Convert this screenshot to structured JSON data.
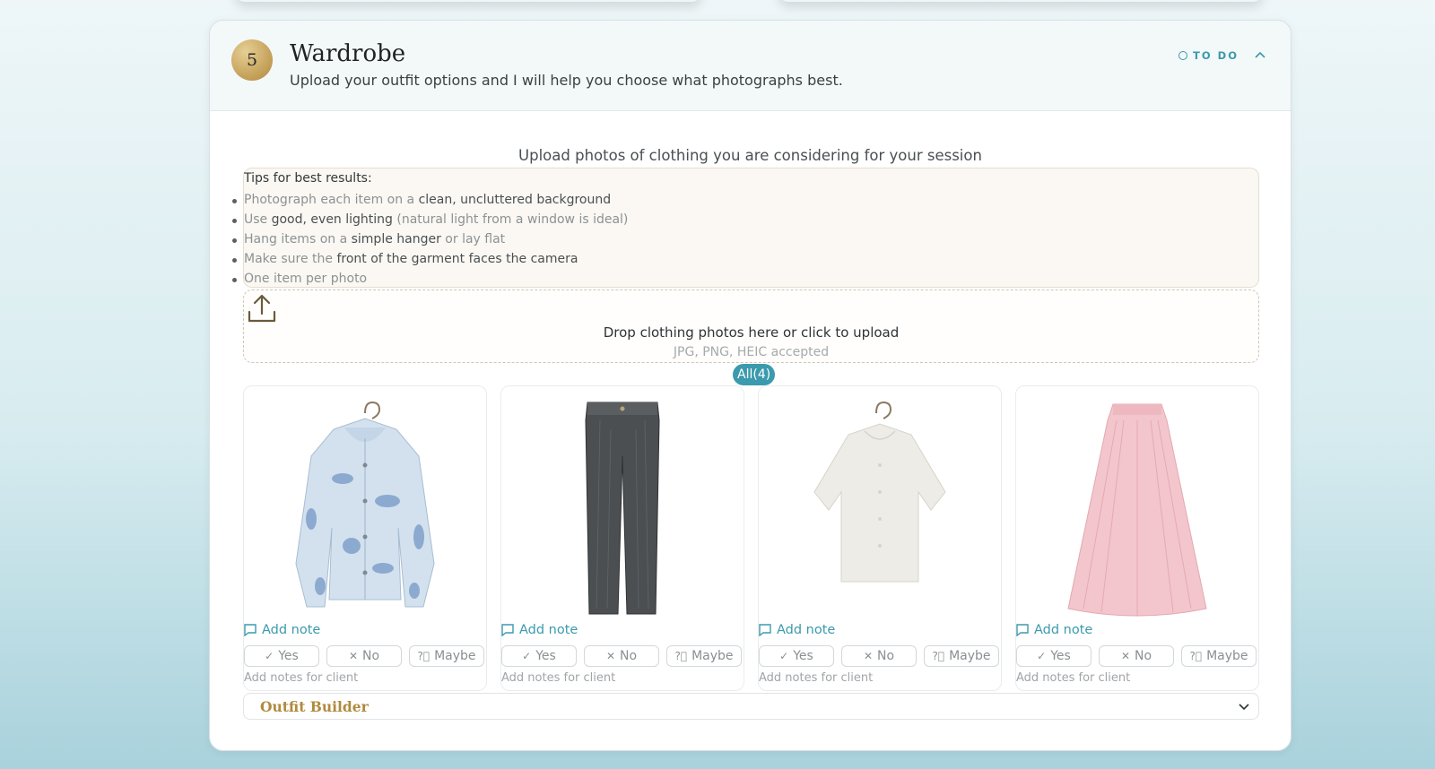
{
  "step": {
    "number": "5",
    "title": "Wardrobe",
    "subtitle": "Upload your outfit options and I will help you choose what photographs best.",
    "status": "TO DO"
  },
  "upload": {
    "heading": "Upload photos of clothing you are considering for your session",
    "tips_title": "Tips for best results:",
    "tips": [
      [
        "Photograph each item on a ",
        "clean, uncluttered background",
        ""
      ],
      [
        "Use ",
        "good, even lighting",
        " (natural light from a window is ideal)"
      ],
      [
        "Hang items on a ",
        "simple hanger",
        " or lay flat"
      ],
      [
        "Make sure the ",
        "front of the garment faces the camera",
        ""
      ],
      [
        "One item per photo",
        "",
        ""
      ]
    ],
    "drop_text": "Drop clothing photos here or click to upload",
    "drop_sub": "JPG, PNG, HEIC accepted"
  },
  "filter": {
    "label": "All(4)"
  },
  "items": [
    {
      "kind": "denim-jacket",
      "add_note": "Add note",
      "yes": "Yes",
      "no": "No",
      "maybe": "Maybe",
      "client_notes": "Add notes for client"
    },
    {
      "kind": "jeans",
      "add_note": "Add note",
      "yes": "Yes",
      "no": "No",
      "maybe": "Maybe",
      "client_notes": "Add notes for client"
    },
    {
      "kind": "knit-top",
      "add_note": "Add note",
      "yes": "Yes",
      "no": "No",
      "maybe": "Maybe",
      "client_notes": "Add notes for client"
    },
    {
      "kind": "pink-skirt",
      "add_note": "Add note",
      "yes": "Yes",
      "no": "No",
      "maybe": "Maybe",
      "client_notes": "Add notes for client"
    }
  ],
  "outfit_builder": {
    "label": "Outfit Builder"
  },
  "colors": {
    "accent": "#3b9aad",
    "gold": "#b08a3e"
  }
}
